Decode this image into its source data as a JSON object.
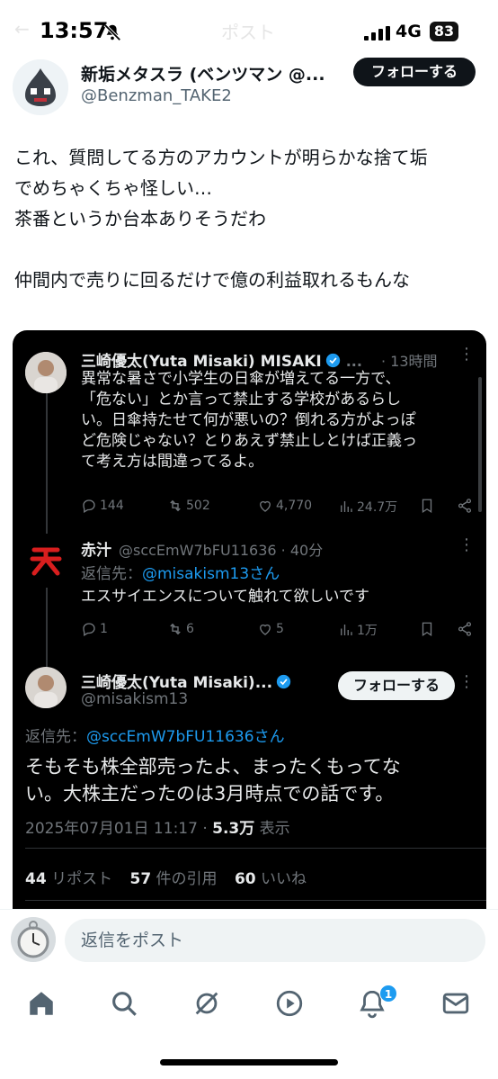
{
  "status_bar": {
    "time": "13:57",
    "network": "4G",
    "battery": "83"
  },
  "nav": {
    "back": "←",
    "title": "ポスト"
  },
  "post": {
    "author_name": "新垢メタスラ (ベンツマン @...",
    "handle": "@Benzman_TAKE2",
    "follow_label": "フォローする",
    "lines": [
      "これ、質問してる方のアカウントが明らかな捨て垢",
      "でめちゃくちゃ怪しい…",
      "茶番というか台本ありそうだわ",
      "",
      "仲間内で売りに回るだけで億の利益取れるもんな"
    ]
  },
  "embed": {
    "tweet1": {
      "name": "三崎優太(Yuta Misaki) MISAKI",
      "ellipsis": "...",
      "time": "· 13時間",
      "lines": [
        "異常な暑さで小学生の日傘が増えてる一方で、",
        "「危ない」とか言って禁止する学校があるらし",
        "い。日傘持たせて何が悪いの？倒れる方がよっぽ",
        "ど危険じゃない？とりあえず禁止しとけば正義っ",
        "て考え方は間違ってるよ。"
      ],
      "replies": "144",
      "reposts": "502",
      "likes": "4,770",
      "views": "24.7万"
    },
    "tweet2": {
      "name": "赤汁",
      "handle": "@sccEmW7bFU11636 · 40分",
      "reply_prefix": "返信先：",
      "reply_to": "@misakism13さん",
      "text": "エスサイエンスについて触れて欲しいです",
      "replies": "1",
      "reposts": "6",
      "likes": "5",
      "views": "1万"
    },
    "focus": {
      "name": "三崎優太(Yuta Misaki)...",
      "handle": "@misakism13",
      "follow_label": "フォローする",
      "reply_prefix": "返信先：",
      "reply_to": "@sccEmW7bFU11636さん",
      "lines": [
        "そもそも株全部売ったよ、まったくもってな",
        "い。大株主だったのは3月時点での話です。"
      ],
      "date": "2025年07月01日 11:17 · ",
      "views_count": "5.3万",
      "views_label": " 表示",
      "reposts_count": "44",
      "reposts_label": " リポスト",
      "quotes_count": "57",
      "quotes_label": " 件の引用",
      "likes_count": "60",
      "likes_label": " いいね"
    }
  },
  "reply_bar": {
    "placeholder": "返信をポスト"
  },
  "tabbar": {
    "notification_count": "1"
  },
  "colors": {
    "accent": "#1d9bf0",
    "embed_bg": "#000000",
    "muted": "#71767b"
  }
}
